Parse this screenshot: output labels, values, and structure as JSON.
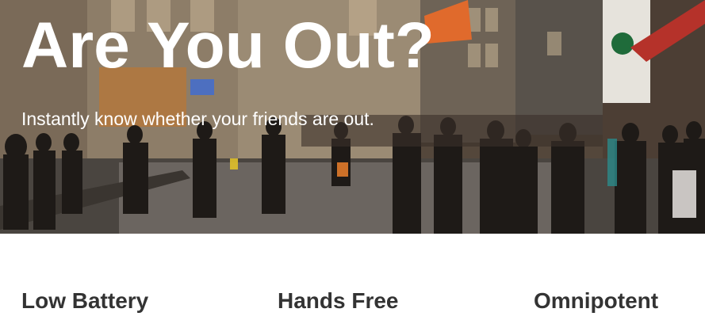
{
  "hero": {
    "title": "Are You Out?",
    "subtitle": "Instantly know whether your friends are out."
  },
  "features": [
    {
      "heading": "Low Battery"
    },
    {
      "heading": "Hands Free"
    },
    {
      "heading": "Omnipotent"
    }
  ],
  "colors": {
    "hero_text": "#ffffff",
    "heading_text": "#333333",
    "page_background": "#ffffff"
  }
}
